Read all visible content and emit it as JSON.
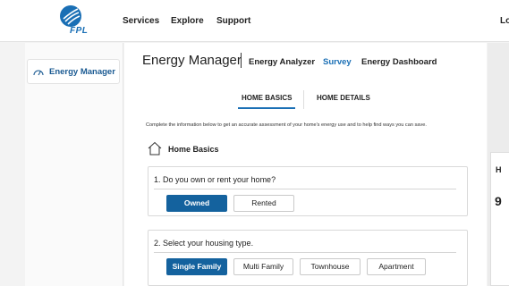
{
  "brand": {
    "logo_text": "FPL",
    "color": "#1a6fb5"
  },
  "topnav": {
    "links": [
      "Services",
      "Explore",
      "Support"
    ],
    "login_label": "Lo"
  },
  "sidebar": {
    "active_item": "Energy Manager"
  },
  "header": {
    "title": "Energy Manager",
    "tabs": [
      {
        "label": "Energy Analyzer",
        "active": false
      },
      {
        "label": "Survey",
        "active": true
      },
      {
        "label": "Energy Dashboard",
        "active": false
      }
    ]
  },
  "survey": {
    "subtabs": [
      {
        "label": "HOME BASICS",
        "active": true
      },
      {
        "label": "HOME DETAILS",
        "active": false
      }
    ],
    "instructions": "Complete the information below to get an accurate assessment of your home's energy use and to help find ways you can save.",
    "section_title": "Home Basics",
    "questions": [
      {
        "text": "1.  Do you own or rent your home?",
        "options": [
          "Owned",
          "Rented"
        ],
        "selected": "Owned"
      },
      {
        "text": "2.  Select your housing type.",
        "options": [
          "Single Family",
          "Multi Family",
          "Townhouse",
          "Apartment"
        ],
        "selected": "Single Family"
      }
    ]
  },
  "side_panel_peek": {
    "heading": "H",
    "glyph": "9"
  },
  "colors": {
    "accent": "#1a6fb5",
    "selected_button": "#14629e"
  }
}
